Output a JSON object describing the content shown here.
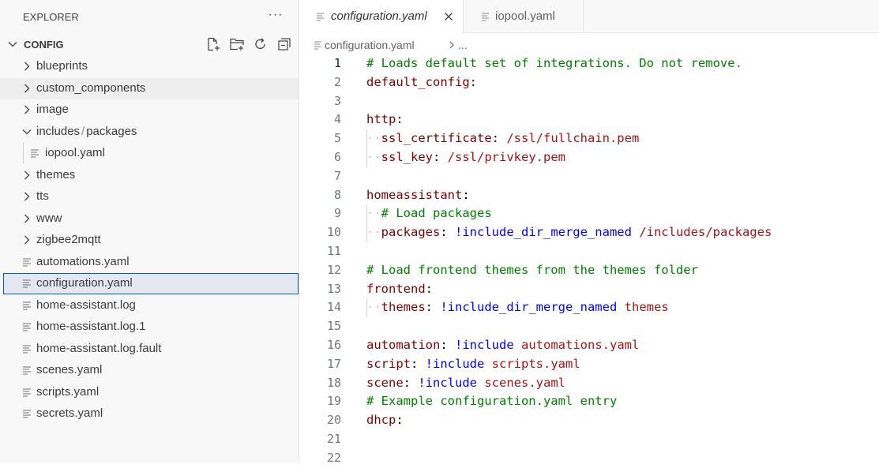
{
  "sidebar": {
    "title": "EXPLORER",
    "more_actions": "···",
    "section": {
      "title": "CONFIG",
      "actions": [
        {
          "name": "new-file-icon"
        },
        {
          "name": "new-folder-icon"
        },
        {
          "name": "refresh-icon"
        },
        {
          "name": "collapse-all-icon"
        }
      ]
    },
    "tree": [
      {
        "label": "blueprints",
        "type": "folder",
        "expanded": false,
        "depth": 0
      },
      {
        "label": "custom_components",
        "type": "folder",
        "expanded": false,
        "depth": 0,
        "hover": true
      },
      {
        "label": "image",
        "type": "folder",
        "expanded": false,
        "depth": 0
      },
      {
        "label": "includes",
        "label_sep": "/",
        "label_tail": "packages",
        "type": "folder",
        "expanded": true,
        "depth": 0
      },
      {
        "label": "iopool.yaml",
        "type": "file",
        "depth": 1
      },
      {
        "label": "themes",
        "type": "folder",
        "expanded": false,
        "depth": 0
      },
      {
        "label": "tts",
        "type": "folder",
        "expanded": false,
        "depth": 0
      },
      {
        "label": "www",
        "type": "folder",
        "expanded": false,
        "depth": 0
      },
      {
        "label": "zigbee2mqtt",
        "type": "folder",
        "expanded": false,
        "depth": 0
      },
      {
        "label": "automations.yaml",
        "type": "file",
        "depth": 0
      },
      {
        "label": "configuration.yaml",
        "type": "file",
        "depth": 0,
        "selected": true
      },
      {
        "label": "home-assistant.log",
        "type": "file",
        "depth": 0
      },
      {
        "label": "home-assistant.log.1",
        "type": "file",
        "depth": 0
      },
      {
        "label": "home-assistant.log.fault",
        "type": "file",
        "depth": 0
      },
      {
        "label": "scenes.yaml",
        "type": "file",
        "depth": 0
      },
      {
        "label": "scripts.yaml",
        "type": "file",
        "depth": 0
      },
      {
        "label": "secrets.yaml",
        "type": "file",
        "depth": 0
      }
    ]
  },
  "tabs": [
    {
      "label": "configuration.yaml",
      "active": true
    },
    {
      "label": "iopool.yaml",
      "active": false
    }
  ],
  "breadcrumb": {
    "file": "configuration.yaml",
    "more": "..."
  },
  "editor": {
    "active_line": 1,
    "lines": [
      {
        "n": "1",
        "parts": [
          {
            "t": "# Loads default set of integrations. Do not remove.",
            "c": "com"
          }
        ]
      },
      {
        "n": "2",
        "parts": [
          {
            "t": "default_config",
            "c": "key"
          },
          {
            "t": ":",
            "c": ""
          }
        ]
      },
      {
        "n": "3",
        "parts": []
      },
      {
        "n": "4",
        "parts": [
          {
            "t": "http",
            "c": "key"
          },
          {
            "t": ":",
            "c": ""
          }
        ]
      },
      {
        "n": "5",
        "indent": true,
        "parts": [
          {
            "t": "··",
            "c": "ws"
          },
          {
            "t": "ssl_certificate",
            "c": "key"
          },
          {
            "t": ": ",
            "c": ""
          },
          {
            "t": "/ssl/fullchain.pem",
            "c": "str"
          }
        ]
      },
      {
        "n": "6",
        "indent": true,
        "parts": [
          {
            "t": "··",
            "c": "ws"
          },
          {
            "t": "ssl_key",
            "c": "key"
          },
          {
            "t": ": ",
            "c": ""
          },
          {
            "t": "/ssl/privkey.pem",
            "c": "str"
          }
        ]
      },
      {
        "n": "7",
        "parts": []
      },
      {
        "n": "8",
        "parts": [
          {
            "t": "homeassistant",
            "c": "key"
          },
          {
            "t": ":",
            "c": ""
          }
        ]
      },
      {
        "n": "9",
        "indent": true,
        "parts": [
          {
            "t": "··",
            "c": "ws"
          },
          {
            "t": "# Load packages",
            "c": "com"
          }
        ]
      },
      {
        "n": "10",
        "indent": true,
        "parts": [
          {
            "t": "··",
            "c": "ws"
          },
          {
            "t": "packages",
            "c": "key"
          },
          {
            "t": ": ",
            "c": ""
          },
          {
            "t": "!include_dir_merge_named",
            "c": "tag"
          },
          {
            "t": " ",
            "c": ""
          },
          {
            "t": "/includes/packages",
            "c": "str"
          }
        ]
      },
      {
        "n": "11",
        "parts": []
      },
      {
        "n": "12",
        "parts": [
          {
            "t": "# Load frontend themes from the themes folder",
            "c": "com"
          }
        ]
      },
      {
        "n": "13",
        "parts": [
          {
            "t": "frontend",
            "c": "key"
          },
          {
            "t": ":",
            "c": ""
          }
        ]
      },
      {
        "n": "14",
        "indent": true,
        "parts": [
          {
            "t": "··",
            "c": "ws"
          },
          {
            "t": "themes",
            "c": "key"
          },
          {
            "t": ": ",
            "c": ""
          },
          {
            "t": "!include_dir_merge_named",
            "c": "tag"
          },
          {
            "t": " ",
            "c": ""
          },
          {
            "t": "themes",
            "c": "str"
          }
        ]
      },
      {
        "n": "15",
        "parts": []
      },
      {
        "n": "16",
        "parts": [
          {
            "t": "automation",
            "c": "key"
          },
          {
            "t": ": ",
            "c": ""
          },
          {
            "t": "!include",
            "c": "tag"
          },
          {
            "t": " ",
            "c": ""
          },
          {
            "t": "automations.yaml",
            "c": "str"
          }
        ]
      },
      {
        "n": "17",
        "parts": [
          {
            "t": "script",
            "c": "key"
          },
          {
            "t": ": ",
            "c": ""
          },
          {
            "t": "!include",
            "c": "tag"
          },
          {
            "t": " ",
            "c": ""
          },
          {
            "t": "scripts.yaml",
            "c": "str"
          }
        ]
      },
      {
        "n": "18",
        "parts": [
          {
            "t": "scene",
            "c": "key"
          },
          {
            "t": ": ",
            "c": ""
          },
          {
            "t": "!include",
            "c": "tag"
          },
          {
            "t": " ",
            "c": ""
          },
          {
            "t": "scenes.yaml",
            "c": "str"
          }
        ]
      },
      {
        "n": "19",
        "parts": [
          {
            "t": "# Example configuration.yaml entry",
            "c": "com"
          }
        ]
      },
      {
        "n": "20",
        "parts": [
          {
            "t": "dhcp",
            "c": "key"
          },
          {
            "t": ":",
            "c": ""
          }
        ]
      },
      {
        "n": "21",
        "parts": []
      },
      {
        "n": "22",
        "parts": []
      }
    ]
  },
  "colors": {
    "comment": "#008000",
    "key": "#800000",
    "string": "#a31515",
    "tag": "#0000ff",
    "selection_border": "#005fb8"
  }
}
